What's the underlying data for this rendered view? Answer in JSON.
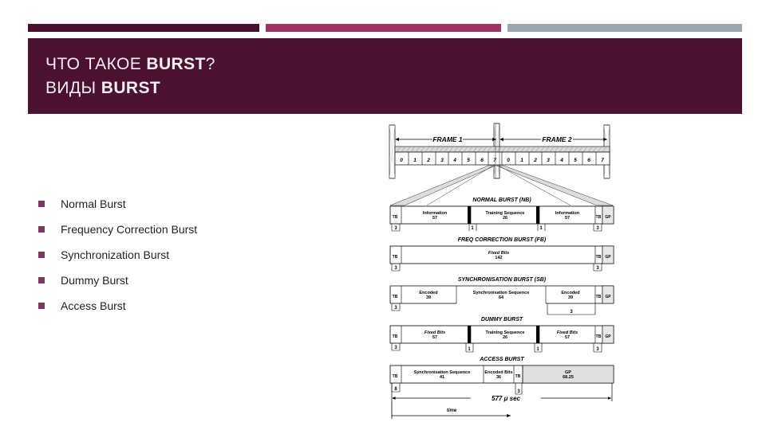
{
  "slide": {
    "title_line_1_prefix": "ЧТО ТАКОЕ ",
    "title_line_1_bold": "BURST",
    "title_line_1_suffix": "?",
    "title_line_2_prefix": "ВИДЫ ",
    "title_line_2_bold": "BURST",
    "title_line_2_suffix": ""
  },
  "colors": {
    "header_background": "#4b1133",
    "strip_dark": "#47112f",
    "strip_pink": "#9d3465",
    "strip_gray": "#9aa7b0",
    "bullet_marker": "#803663",
    "title_text": "#f3eef1",
    "body_text": "#231f20"
  },
  "bullets": [
    {
      "label": "Normal Burst"
    },
    {
      "label": "Frequency Correction Burst"
    },
    {
      "label": "Synchronization Burst"
    },
    {
      "label": "Dummy Burst"
    },
    {
      "label": "Access Burst"
    }
  ],
  "diagram": {
    "frames": [
      {
        "label": "FRAME 1",
        "slots": [
          "0",
          "1",
          "2",
          "3",
          "4",
          "5",
          "6",
          "7"
        ]
      },
      {
        "label": "FRAME 2",
        "slots": [
          "0",
          "1",
          "2",
          "3",
          "4",
          "5",
          "6",
          "7"
        ]
      }
    ],
    "bursts": [
      {
        "title": "NORMAL BURST (NB)",
        "fields": [
          {
            "name": "TB",
            "value": "3"
          },
          {
            "name": "Information",
            "value": "57"
          },
          {
            "name": "",
            "value": "1"
          },
          {
            "name": "Training Sequence",
            "value": "26"
          },
          {
            "name": "",
            "value": "1"
          },
          {
            "name": "Information",
            "value": "57"
          },
          {
            "name": "TB",
            "value": "3"
          },
          {
            "name": "GP",
            "value": ""
          }
        ]
      },
      {
        "title": "FREQ CORRECTION BURST (FB)",
        "fields": [
          {
            "name": "TB",
            "value": "3"
          },
          {
            "name": "Fixed Bits",
            "value": "142"
          },
          {
            "name": "TB",
            "value": "3"
          },
          {
            "name": "GP",
            "value": ""
          }
        ]
      },
      {
        "title": "SYNCHRONISATION BURST (SB)",
        "fields": [
          {
            "name": "TB",
            "value": "3"
          },
          {
            "name": "Encoded",
            "value": "39"
          },
          {
            "name": "Synchronisation Sequence",
            "value": "64"
          },
          {
            "name": "Encoded",
            "value": "39"
          },
          {
            "name": "TB",
            "value": "3"
          },
          {
            "name": "GP",
            "value": ""
          }
        ]
      },
      {
        "title": "DUMMY BURST",
        "fields": [
          {
            "name": "TB",
            "value": "3"
          },
          {
            "name": "Fixed Bits",
            "value": "57"
          },
          {
            "name": "",
            "value": "1"
          },
          {
            "name": "Training Sequence",
            "value": "26"
          },
          {
            "name": "",
            "value": "1"
          },
          {
            "name": "Fixed Bits",
            "value": "57"
          },
          {
            "name": "TB",
            "value": "3"
          },
          {
            "name": "GP",
            "value": ""
          }
        ]
      },
      {
        "title": "ACCESS BURST",
        "fields": [
          {
            "name": "TB",
            "value": "8"
          },
          {
            "name": "Synchronisation Sequence",
            "value": "41"
          },
          {
            "name": "Encoded Bits",
            "value": "36"
          },
          {
            "name": "TB",
            "value": "3"
          },
          {
            "name": "GP",
            "value": "68.25"
          }
        ]
      }
    ],
    "dimensions": {
      "duration_label": "577 μ sec",
      "time_axis_label": "time"
    }
  }
}
